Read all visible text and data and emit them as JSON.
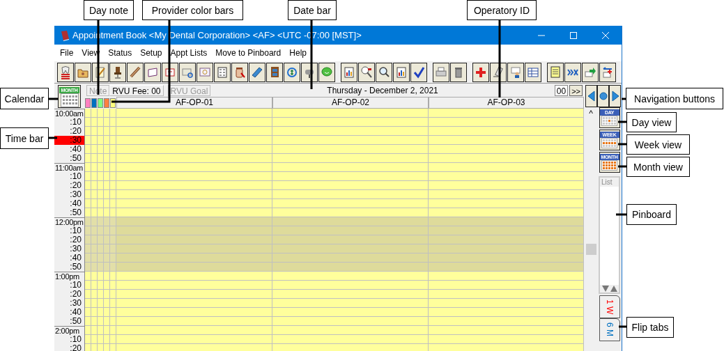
{
  "callouts": [
    {
      "label": "Day note"
    },
    {
      "label": "Provider color bars"
    },
    {
      "label": "Date bar"
    },
    {
      "label": "Operatory ID"
    },
    {
      "label": "Calendar"
    },
    {
      "label": "Navigation buttons"
    },
    {
      "label": "Day view"
    },
    {
      "label": "Time bar"
    },
    {
      "label": "Week view"
    },
    {
      "label": "Month view"
    },
    {
      "label": "Pinboard"
    },
    {
      "label": "Flip tabs"
    }
  ],
  "window": {
    "title": "Appointment Book <My Dental Corporation> <AF> <UTC -07:00 [MST]>"
  },
  "menu": [
    "File",
    "View",
    "Status",
    "Setup",
    "Appt Lists",
    "Move to Pinboard",
    "Help"
  ],
  "calendar_button": {
    "label": "MONTH"
  },
  "header": {
    "note": {
      "label": "Note",
      "disabled": true
    },
    "rvu_fee": "RVU Fee: 00",
    "rvu_goal": {
      "label": "RVU Goal",
      "disabled": true
    },
    "date": "Thursday - December 2, 2021",
    "counter": "00",
    "next": ">>"
  },
  "providers": [
    {
      "color": "#ff80c0"
    },
    {
      "color": "#0070c0"
    },
    {
      "color": "#80ff80"
    },
    {
      "color": "#ff8040"
    },
    {
      "color": "#ffff80"
    }
  ],
  "operatories": [
    "AF-OP-01",
    "AF-OP-02",
    "AF-OP-03"
  ],
  "time_rows": [
    {
      "label": "10:00am",
      "kind": "hour",
      "current": false,
      "blocked": false
    },
    {
      "label": ":10",
      "kind": "minute",
      "current": false,
      "blocked": false
    },
    {
      "label": ":20",
      "kind": "minute",
      "current": false,
      "blocked": false
    },
    {
      "label": ":30",
      "kind": "minute",
      "current": true,
      "blocked": false
    },
    {
      "label": ":40",
      "kind": "minute",
      "current": false,
      "blocked": false
    },
    {
      "label": ":50",
      "kind": "minute",
      "current": false,
      "blocked": false
    },
    {
      "label": "11:00am",
      "kind": "hour",
      "current": false,
      "blocked": false
    },
    {
      "label": ":10",
      "kind": "minute",
      "current": false,
      "blocked": false
    },
    {
      "label": ":20",
      "kind": "minute",
      "current": false,
      "blocked": false
    },
    {
      "label": ":30",
      "kind": "minute",
      "current": false,
      "blocked": false
    },
    {
      "label": ":40",
      "kind": "minute",
      "current": false,
      "blocked": false
    },
    {
      "label": ":50",
      "kind": "minute",
      "current": false,
      "blocked": false
    },
    {
      "label": "12:00pm",
      "kind": "hour",
      "current": false,
      "blocked": true
    },
    {
      "label": ":10",
      "kind": "minute",
      "current": false,
      "blocked": true
    },
    {
      "label": ":20",
      "kind": "minute",
      "current": false,
      "blocked": true
    },
    {
      "label": ":30",
      "kind": "minute",
      "current": false,
      "blocked": true
    },
    {
      "label": ":40",
      "kind": "minute",
      "current": false,
      "blocked": true
    },
    {
      "label": ":50",
      "kind": "minute",
      "current": false,
      "blocked": true
    },
    {
      "label": "1:00pm",
      "kind": "hour",
      "current": false,
      "blocked": false
    },
    {
      "label": ":10",
      "kind": "minute",
      "current": false,
      "blocked": false
    },
    {
      "label": ":20",
      "kind": "minute",
      "current": false,
      "blocked": false
    },
    {
      "label": ":30",
      "kind": "minute",
      "current": false,
      "blocked": false
    },
    {
      "label": ":40",
      "kind": "minute",
      "current": false,
      "blocked": false
    },
    {
      "label": ":50",
      "kind": "minute",
      "current": false,
      "blocked": false
    },
    {
      "label": "2:00pm",
      "kind": "hour",
      "current": false,
      "blocked": false
    },
    {
      "label": ":10",
      "kind": "minute",
      "current": false,
      "blocked": false
    },
    {
      "label": ":20",
      "kind": "minute",
      "current": false,
      "blocked": false
    }
  ],
  "scrollbar": {
    "up": "^"
  },
  "view_buttons": [
    {
      "label": "DAY",
      "kind": "day"
    },
    {
      "label": "WEEK",
      "kind": "week"
    },
    {
      "label": "MONTH",
      "kind": "month"
    }
  ],
  "pinboard": {
    "title": "List"
  },
  "flip_tabs": [
    {
      "label": "1 W",
      "color": "#ff0000"
    },
    {
      "label": "6 M",
      "color": "#0070c0"
    }
  ]
}
